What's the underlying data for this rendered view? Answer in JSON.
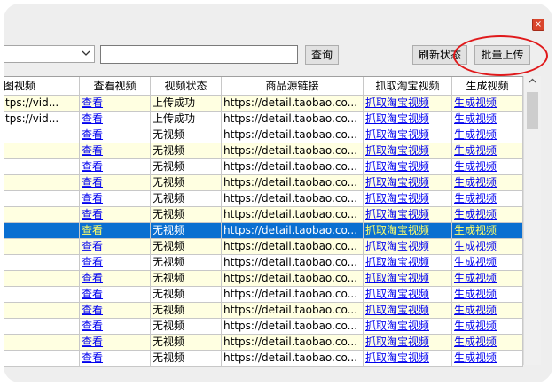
{
  "window": {
    "close_glyph": "×"
  },
  "toolbar": {
    "dropdown_value": "",
    "search_value": "",
    "query_label": "查询",
    "refresh_label": "刷新状态",
    "batch_upload_label": "批量上传"
  },
  "table": {
    "columns": [
      "图视频",
      "查看视频",
      "视频状态",
      "商品源链接",
      "抓取淘宝视频",
      "生成视频"
    ],
    "rows": [
      {
        "video": "tps://vid...",
        "view": "查看",
        "status": "上传成功",
        "url": "https://detail.taobao.co...",
        "grab": "抓取淘宝视频",
        "gen": "生成视频",
        "style": "yellow"
      },
      {
        "video": "tps://vid...",
        "view": "查看",
        "status": "上传成功",
        "url": "https://detail.taobao.co...",
        "grab": "抓取淘宝视频",
        "gen": "生成视频",
        "style": "white"
      },
      {
        "video": "",
        "view": "查看",
        "status": "无视频",
        "url": "https://detail.taobao.co...",
        "grab": "抓取淘宝视频",
        "gen": "生成视频",
        "style": "white"
      },
      {
        "video": "",
        "view": "查看",
        "status": "无视频",
        "url": "https://detail.taobao.co...",
        "grab": "抓取淘宝视频",
        "gen": "生成视频",
        "style": "yellow"
      },
      {
        "video": "",
        "view": "查看",
        "status": "无视频",
        "url": "https://detail.taobao.co...",
        "grab": "抓取淘宝视频",
        "gen": "生成视频",
        "style": "white"
      },
      {
        "video": "",
        "view": "查看",
        "status": "无视频",
        "url": "https://detail.taobao.co...",
        "grab": "抓取淘宝视频",
        "gen": "生成视频",
        "style": "yellow"
      },
      {
        "video": "",
        "view": "查看",
        "status": "无视频",
        "url": "https://detail.taobao.co...",
        "grab": "抓取淘宝视频",
        "gen": "生成视频",
        "style": "white"
      },
      {
        "video": "",
        "view": "查看",
        "status": "无视频",
        "url": "https://detail.taobao.co...",
        "grab": "抓取淘宝视频",
        "gen": "生成视频",
        "style": "yellow"
      },
      {
        "video": "",
        "view": "查看",
        "status": "无视频",
        "url": "https://detail.taobao.co...",
        "grab": "抓取淘宝视频",
        "gen": "生成视频",
        "style": "selected"
      },
      {
        "video": "",
        "view": "查看",
        "status": "无视频",
        "url": "https://detail.taobao.co...",
        "grab": "抓取淘宝视频",
        "gen": "生成视频",
        "style": "yellow"
      },
      {
        "video": "",
        "view": "查看",
        "status": "无视频",
        "url": "https://detail.taobao.co...",
        "grab": "抓取淘宝视频",
        "gen": "生成视频",
        "style": "white"
      },
      {
        "video": "",
        "view": "查看",
        "status": "无视频",
        "url": "https://detail.taobao.co...",
        "grab": "抓取淘宝视频",
        "gen": "生成视频",
        "style": "yellow"
      },
      {
        "video": "",
        "view": "查看",
        "status": "无视频",
        "url": "https://detail.taobao.co...",
        "grab": "抓取淘宝视频",
        "gen": "生成视频",
        "style": "white"
      },
      {
        "video": "",
        "view": "查看",
        "status": "无视频",
        "url": "https://detail.taobao.co...",
        "grab": "抓取淘宝视频",
        "gen": "生成视频",
        "style": "yellow"
      },
      {
        "video": "",
        "view": "查看",
        "status": "无视频",
        "url": "https://detail.taobao.co...",
        "grab": "抓取淘宝视频",
        "gen": "生成视频",
        "style": "white"
      },
      {
        "video": "",
        "view": "查看",
        "status": "无视频",
        "url": "https://detail.taobao.co...",
        "grab": "抓取淘宝视频",
        "gen": "生成视频",
        "style": "yellow"
      },
      {
        "video": "",
        "view": "查看",
        "status": "无视频",
        "url": "https://detail.taobao.co...",
        "grab": "抓取淘宝视频",
        "gen": "生成视频",
        "style": "white"
      }
    ]
  },
  "colors": {
    "row_yellow": "#ffffe1",
    "row_white": "#ffffff",
    "row_selected": "#0a6fd1",
    "link": "#0000ee",
    "highlight_circle": "#e0191b"
  },
  "icons": {
    "close": "close-icon",
    "dropdown": "chevron-down-icon",
    "scroll_up": "scroll-up-arrow-icon"
  },
  "scrollbar_chevron": "▲",
  "dropdown_chevron": "⌵"
}
